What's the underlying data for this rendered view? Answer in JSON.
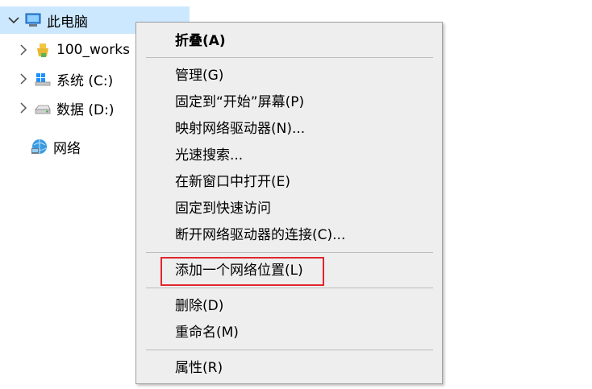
{
  "tree": {
    "items": [
      {
        "label": "此电脑",
        "icon": "computer-icon"
      },
      {
        "label": "100_works",
        "icon": "folder-icon"
      },
      {
        "label": "系统 (C:)",
        "icon": "windows-drive-icon"
      },
      {
        "label": "数据 (D:)",
        "icon": "drive-icon"
      },
      {
        "label": "网络",
        "icon": "network-icon"
      }
    ]
  },
  "context_menu": {
    "collapse": "折叠(A)",
    "manage": "管理(G)",
    "pin_start": "固定到“开始”屏幕(P)",
    "map_drive": "映射网络驱动器(N)...",
    "quick_search": "光速搜索...",
    "open_new_window": "在新窗口中打开(E)",
    "pin_quick_access": "固定到快速访问",
    "disconnect_drive": "断开网络驱动器的连接(C)...",
    "add_network_location": "添加一个网络位置(L)",
    "delete": "删除(D)",
    "rename": "重命名(M)",
    "properties": "属性(R)"
  },
  "colors": {
    "selected_bg": "#cce8ff",
    "menu_bg": "#eeeeee",
    "highlight": "#e0262e"
  }
}
